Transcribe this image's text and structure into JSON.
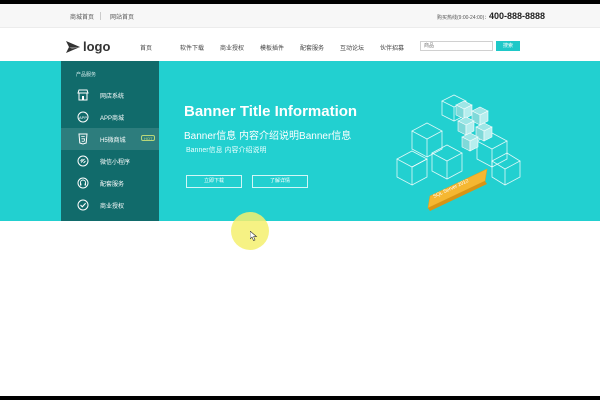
{
  "topbar": {
    "links": [
      "商城首页",
      "网站首页"
    ],
    "hotline_label": "购买热线(9:00-24:00)：",
    "hotline_number": "400-888-8888"
  },
  "nav": {
    "logo_text": "logo",
    "items": [
      "首页",
      "软件下载",
      "商业授权",
      "模板插件",
      "配套服务",
      "互动论坛",
      "伙伴招募"
    ],
    "search_placeholder": "商品",
    "search_button": "搜索"
  },
  "sidebar": {
    "header": "产品服务",
    "items": [
      {
        "label": "网店系统",
        "icon": "store-icon"
      },
      {
        "label": "APP商城",
        "icon": "app-icon"
      },
      {
        "label": "H5微商城",
        "icon": "html5-icon",
        "badge": "HOT",
        "active": true
      },
      {
        "label": "微信小程序",
        "icon": "link-icon"
      },
      {
        "label": "配套服务",
        "icon": "headset-icon"
      },
      {
        "label": "商业授权",
        "icon": "check-circle-icon"
      }
    ]
  },
  "banner": {
    "title": "Banner Title Information",
    "subtitle": "Banner信息 内容介绍说明Banner信息",
    "description": "Banner信息 内容介绍说明",
    "download_button": "立即下载",
    "details_button": "了解详情",
    "art_label": "SQL Server 2012",
    "background": "#22d0d0",
    "accent": "#f5b731"
  }
}
